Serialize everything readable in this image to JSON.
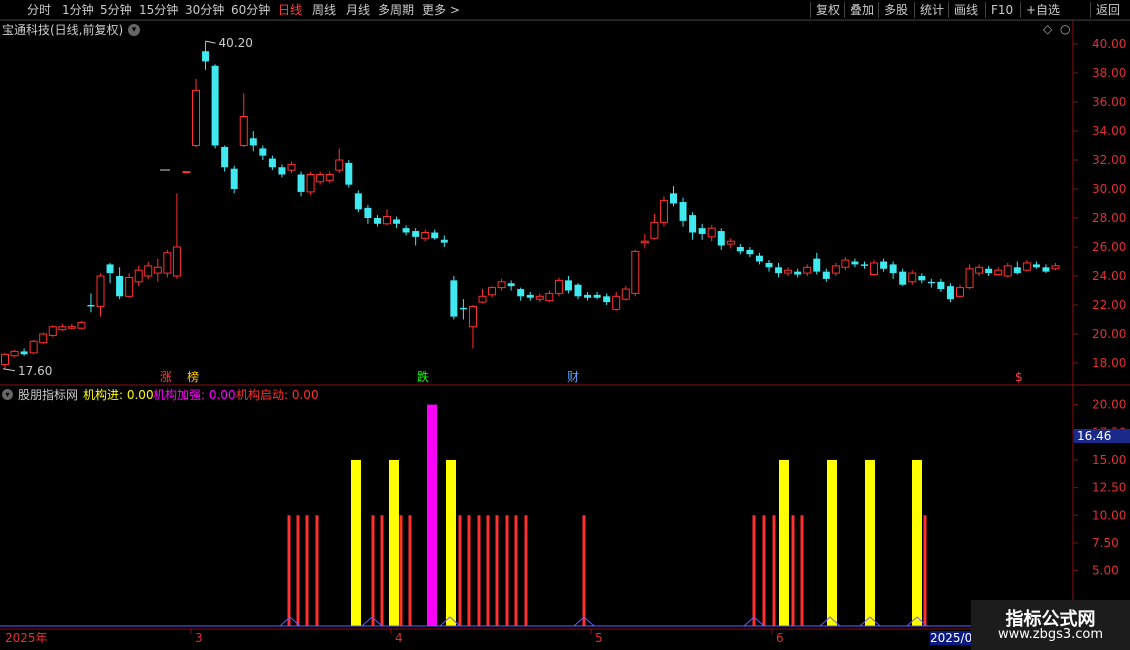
{
  "toolbar": {
    "periods": [
      "分时",
      "1分钟",
      "5分钟",
      "15分钟",
      "30分钟",
      "60分钟",
      "日线",
      "周线",
      "月线",
      "多周期",
      "更多 >"
    ],
    "active_period": "日线",
    "right_buttons": [
      "复权",
      "叠加",
      "多股",
      "统计",
      "画线",
      "F10",
      "+自选",
      "返回"
    ]
  },
  "stock": {
    "title": "宝通科技(日线,前复权)",
    "high_label": "40.20",
    "low_label": "17.60"
  },
  "price_axis": [
    "40.00",
    "38.00",
    "36.00",
    "34.00",
    "32.00",
    "30.00",
    "28.00",
    "26.00",
    "24.00",
    "22.00",
    "20.00",
    "18.00"
  ],
  "event_markers": [
    {
      "label": "涨",
      "color": "#ff4040"
    },
    {
      "label": "榜",
      "color": "#ffcc00"
    },
    {
      "label": "跌",
      "color": "#00ff00"
    },
    {
      "label": "财",
      "color": "#60a0ff"
    },
    {
      "label": "$",
      "color": "#ff4040"
    }
  ],
  "indicator": {
    "name": "股朋指标网",
    "items": [
      {
        "label": "机构进: 0.00",
        "color": "#ffff00"
      },
      {
        "label": "机构加强: 0.00",
        "color": "#ff00ff"
      },
      {
        "label": "机构启动: 0.00",
        "color": "#ff3030"
      }
    ],
    "axis": [
      "20.00",
      "17.50",
      "15.00",
      "12.50",
      "10.00",
      "7.50",
      "5.00"
    ],
    "current_value": "16.46"
  },
  "dates": {
    "start": "2025年",
    "m3": "3",
    "m4": "4",
    "m5": "5",
    "m6": "6",
    "end_box": "2025/06"
  },
  "watermark": {
    "line1": "指标公式网",
    "line2": "www.zbgs3.com"
  },
  "colors": {
    "up": "#ff3030",
    "down": "#40e8f0",
    "yellow": "#ffff00",
    "magenta": "#ff00ff",
    "grid_red": "#8a1010"
  },
  "chart_data": [
    {
      "type": "candlestick",
      "title": "宝通科技(日线,前复权)",
      "ylim": [
        17,
        41
      ],
      "y_ticks": [
        18,
        20,
        22,
        24,
        26,
        28,
        30,
        32,
        34,
        36,
        38,
        40
      ],
      "annotations": [
        {
          "text": "40.20",
          "value": 40.2
        },
        {
          "text": "17.60",
          "value": 17.6
        }
      ],
      "note": "Daily candles, approx. 110 bars; values estimated from gridlines. [open,close,high,low]",
      "candles": [
        [
          17.9,
          18.6,
          18.7,
          17.6
        ],
        [
          18.5,
          18.8,
          18.9,
          18.4
        ],
        [
          18.8,
          18.6,
          19.0,
          18.5
        ],
        [
          18.7,
          19.5,
          19.6,
          18.6
        ],
        [
          19.4,
          20.0,
          20.1,
          19.3
        ],
        [
          19.9,
          20.5,
          20.6,
          19.8
        ],
        [
          20.3,
          20.5,
          20.7,
          20.2
        ],
        [
          20.4,
          20.5,
          20.7,
          20.3
        ],
        [
          20.4,
          20.8,
          20.9,
          20.3
        ],
        [
          22.0,
          21.9,
          22.8,
          21.5
        ],
        [
          21.9,
          24.0,
          24.2,
          21.2
        ],
        [
          24.8,
          24.2,
          24.9,
          23.5
        ],
        [
          24.0,
          22.6,
          24.6,
          22.4
        ],
        [
          22.6,
          23.9,
          24.2,
          22.5
        ],
        [
          23.6,
          24.4,
          24.7,
          23.3
        ],
        [
          24.0,
          24.7,
          25.0,
          23.8
        ],
        [
          24.2,
          24.6,
          25.2,
          23.6
        ],
        [
          24.2,
          25.6,
          25.8,
          23.9
        ],
        [
          24.0,
          26.0,
          29.7,
          23.8
        ],
        [
          31.2,
          31.2,
          31.2,
          31.2
        ],
        [
          33.0,
          36.8,
          37.6,
          32.9
        ],
        [
          39.5,
          38.8,
          40.2,
          38.2
        ],
        [
          38.5,
          33.0,
          38.6,
          32.8
        ],
        [
          32.9,
          31.5,
          33.0,
          31.2
        ],
        [
          31.4,
          30.0,
          31.6,
          29.7
        ],
        [
          33.0,
          35.0,
          36.6,
          32.9
        ],
        [
          33.5,
          33.0,
          34.0,
          32.6
        ],
        [
          32.8,
          32.3,
          33.0,
          32.0
        ],
        [
          32.1,
          31.5,
          32.3,
          31.3
        ],
        [
          31.5,
          31.0,
          31.7,
          30.8
        ],
        [
          31.3,
          31.7,
          31.9,
          31.1
        ],
        [
          31.0,
          29.8,
          31.2,
          29.5
        ],
        [
          29.8,
          31.0,
          31.2,
          29.6
        ],
        [
          30.5,
          31.0,
          31.2,
          30.3
        ],
        [
          30.6,
          31.0,
          31.2,
          30.4
        ],
        [
          31.3,
          32.0,
          32.8,
          31.1
        ],
        [
          31.8,
          30.3,
          32.0,
          30.1
        ],
        [
          29.7,
          28.6,
          29.9,
          28.4
        ],
        [
          28.7,
          28.0,
          28.9,
          27.6
        ],
        [
          28.0,
          27.6,
          28.2,
          27.4
        ],
        [
          27.6,
          28.1,
          28.6,
          27.5
        ],
        [
          27.9,
          27.6,
          28.1,
          27.3
        ],
        [
          27.3,
          27.0,
          27.5,
          26.8
        ],
        [
          27.1,
          26.7,
          27.3,
          26.1
        ],
        [
          26.6,
          27.0,
          27.2,
          26.4
        ],
        [
          27.0,
          26.6,
          27.2,
          26.5
        ],
        [
          26.5,
          26.3,
          26.8,
          26.0
        ],
        [
          23.7,
          21.2,
          24.0,
          21.0
        ],
        [
          21.8,
          21.7,
          22.4,
          21.0
        ],
        [
          20.5,
          21.9,
          22.0,
          19.0
        ],
        [
          22.2,
          22.6,
          23.1,
          22.1
        ],
        [
          22.7,
          23.2,
          23.3,
          22.5
        ],
        [
          23.2,
          23.6,
          23.8,
          23.0
        ],
        [
          23.5,
          23.3,
          23.7,
          23.0
        ],
        [
          23.1,
          22.6,
          23.2,
          22.3
        ],
        [
          22.7,
          22.5,
          22.9,
          22.3
        ],
        [
          22.4,
          22.6,
          22.8,
          22.2
        ],
        [
          22.3,
          22.8,
          23.0,
          22.2
        ],
        [
          22.8,
          23.7,
          23.9,
          22.6
        ],
        [
          23.7,
          23.0,
          24.0,
          22.8
        ],
        [
          23.4,
          22.6,
          23.5,
          22.4
        ],
        [
          22.7,
          22.5,
          22.9,
          22.3
        ],
        [
          22.7,
          22.5,
          22.9,
          22.4
        ],
        [
          22.6,
          22.2,
          22.8,
          22.0
        ],
        [
          21.7,
          22.6,
          22.9,
          21.6
        ],
        [
          22.4,
          23.1,
          23.3,
          22.3
        ],
        [
          22.8,
          25.7,
          25.8,
          22.6
        ],
        [
          26.3,
          26.4,
          26.9,
          25.9
        ],
        [
          26.6,
          27.7,
          28.3,
          26.5
        ],
        [
          27.7,
          29.2,
          29.5,
          27.4
        ],
        [
          29.7,
          29.0,
          30.2,
          28.8
        ],
        [
          29.1,
          27.8,
          29.4,
          27.4
        ],
        [
          28.2,
          27.0,
          28.4,
          26.5
        ],
        [
          27.3,
          26.9,
          27.6,
          26.5
        ],
        [
          26.7,
          27.3,
          27.5,
          26.4
        ],
        [
          27.1,
          26.1,
          27.3,
          25.8
        ],
        [
          26.2,
          26.4,
          26.6,
          25.9
        ],
        [
          26.0,
          25.7,
          26.2,
          25.5
        ],
        [
          25.8,
          25.5,
          26.0,
          25.3
        ],
        [
          25.4,
          25.0,
          25.6,
          24.8
        ],
        [
          24.9,
          24.6,
          25.1,
          24.3
        ],
        [
          24.6,
          24.2,
          24.9,
          23.9
        ],
        [
          24.2,
          24.4,
          24.6,
          24.0
        ],
        [
          24.3,
          24.1,
          24.5,
          23.9
        ],
        [
          24.2,
          24.6,
          24.8,
          24.0
        ],
        [
          25.2,
          24.3,
          25.6,
          24.1
        ],
        [
          24.3,
          23.8,
          24.5,
          23.6
        ],
        [
          24.2,
          24.7,
          24.9,
          24.0
        ],
        [
          24.6,
          25.1,
          25.3,
          24.4
        ],
        [
          25.0,
          24.8,
          25.2,
          24.6
        ],
        [
          24.8,
          24.7,
          25.0,
          24.5
        ],
        [
          24.1,
          24.9,
          25.1,
          24.0
        ],
        [
          25.0,
          24.5,
          25.2,
          24.3
        ],
        [
          24.8,
          24.2,
          25.0,
          23.8
        ],
        [
          24.3,
          23.4,
          24.5,
          23.3
        ],
        [
          23.6,
          24.2,
          24.4,
          23.4
        ],
        [
          24.0,
          23.7,
          24.2,
          23.5
        ],
        [
          23.6,
          23.5,
          23.8,
          23.2
        ],
        [
          23.6,
          23.1,
          23.8,
          22.9
        ],
        [
          23.3,
          22.4,
          23.5,
          22.2
        ],
        [
          22.6,
          23.2,
          23.4,
          22.5
        ],
        [
          23.2,
          24.5,
          24.8,
          23.1
        ],
        [
          24.2,
          24.6,
          24.8,
          24.0
        ],
        [
          24.5,
          24.2,
          24.7,
          24.0
        ],
        [
          24.1,
          24.4,
          24.6,
          24.0
        ],
        [
          24.0,
          24.7,
          24.9,
          23.9
        ],
        [
          24.6,
          24.2,
          25.0,
          24.1
        ],
        [
          24.4,
          24.9,
          25.1,
          24.3
        ],
        [
          24.8,
          24.6,
          25.0,
          24.5
        ],
        [
          24.6,
          24.3,
          24.8,
          24.2
        ],
        [
          24.5,
          24.7,
          24.9,
          24.4
        ],
        [
          24.5,
          24.4,
          24.7,
          24.3
        ],
        [
          24.4,
          24.1,
          24.6,
          23.9
        ],
        [
          23.5,
          23.5,
          23.8,
          22.5
        ],
        [
          23.6,
          24.1,
          24.3,
          23.4
        ]
      ]
    },
    {
      "type": "bar",
      "title": "股朋指标网",
      "ylim": [
        0,
        22
      ],
      "y_ticks": [
        5,
        7.5,
        10,
        12.5,
        15,
        17.5,
        20
      ],
      "note": "Indicator bars over candle index; values estimated.",
      "series": [
        {
          "name": "机构启动",
          "color": "#ff3030",
          "points": [
            [
              50,
              10
            ],
            [
              51,
              10
            ],
            [
              52,
              10
            ],
            [
              53,
              10
            ],
            [
              63,
              10
            ],
            [
              64,
              10
            ],
            [
              65,
              10
            ],
            [
              66,
              10
            ],
            [
              67,
              10
            ],
            [
              68,
              10
            ],
            [
              78,
              10
            ],
            [
              79,
              10
            ],
            [
              80,
              10
            ],
            [
              81,
              10
            ],
            [
              82,
              10
            ],
            [
              83,
              10
            ],
            [
              84,
              10
            ],
            [
              85,
              10
            ],
            [
              86,
              10
            ],
            [
              87,
              10
            ],
            [
              88,
              10
            ],
            [
              89,
              10
            ],
            [
              90,
              10
            ],
            [
              91,
              10
            ],
            [
              101,
              10
            ]
          ]
        },
        {
          "name": "机构进",
          "color": "#ffff00",
          "points": [
            [
              61,
              15
            ],
            [
              67,
              15
            ],
            [
              78,
              15
            ],
            [
              138,
              15
            ],
            [
              145,
              15
            ],
            [
              152,
              15
            ],
            [
              159,
              15
            ]
          ]
        },
        {
          "name": "机构加强",
          "color": "#ff00ff",
          "points": [
            [
              74,
              20
            ]
          ]
        }
      ]
    }
  ]
}
